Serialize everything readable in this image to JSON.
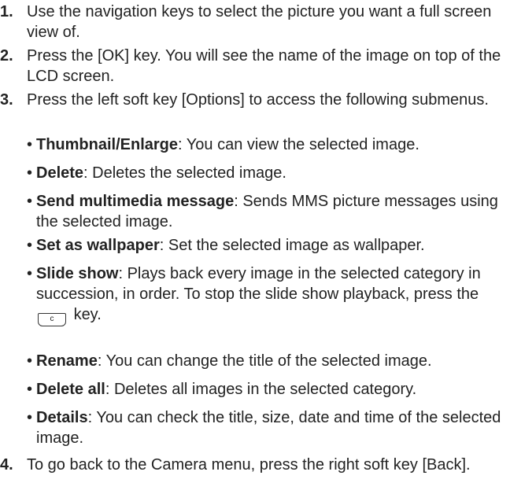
{
  "steps": [
    {
      "num": "1.",
      "text": "Use the navigation keys to select the picture you want a full screen view of."
    },
    {
      "num": "2.",
      "text": "Press the [OK] key. You will see the name of the image on top of the LCD screen."
    },
    {
      "num": "3.",
      "text": "Press the left soft key [Options] to access the following submenus."
    },
    {
      "num": "4.",
      "text": "To go back to the Camera menu, press the right soft key [Back]."
    }
  ],
  "bullets": [
    {
      "term": "Thumbnail/Enlarge",
      "desc": ": You can view the selected image."
    },
    {
      "term": "Delete",
      "desc": ": Deletes the selected image."
    },
    {
      "term": "Send multimedia message",
      "desc": ": Sends MMS picture messages using the selected image."
    },
    {
      "term": "Set as wallpaper",
      "desc": ": Set the selected image as wallpaper."
    },
    {
      "term": "Slide show",
      "desc": ": Plays back every image in the selected category in succession, in order. To stop the slide show playback, press the",
      "desc_after": "key."
    },
    {
      "term": "Rename",
      "desc": ": You can change the title of the selected image."
    },
    {
      "term": "Delete all",
      "desc": ": Deletes all images in the selected category."
    },
    {
      "term": "Details",
      "desc": ": You can check the title, size, date and time of the selected image."
    }
  ],
  "bullet_char": "•",
  "key_glyph": "c"
}
